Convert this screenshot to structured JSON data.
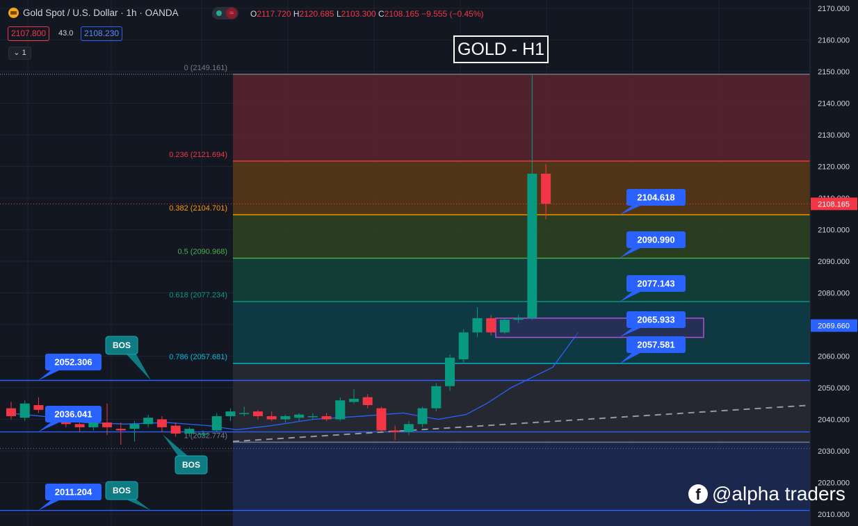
{
  "header": {
    "symbol_title": "Gold Spot / U.S. Dollar · 1h · OANDA",
    "ohlc": {
      "o_key": "O",
      "o": "2117.720",
      "h_key": "H",
      "h": "2120.685",
      "l_key": "L",
      "l": "2103.300",
      "c_key": "C",
      "c": "2108.165",
      "change": "−9.555 (−0.45%)"
    },
    "sell_price": "2107.800",
    "spread": "43.0",
    "buy_price": "2108.230",
    "indicator_count": "1",
    "toggle_wave": "≈"
  },
  "chart_title": "GOLD - H1",
  "watermark": "@alpha traders",
  "colors": {
    "bg": "#131722",
    "bull": "#089981",
    "bear": "#f23645",
    "axis_text": "#d1d4dc",
    "label_blue": "#2962ff",
    "bos": "#0f7b83"
  },
  "chart_data": {
    "type": "candlestick",
    "yrange": [
      2007,
      2172
    ],
    "price_axis_ticks": [
      "2170.000",
      "2160.000",
      "2150.000",
      "2140.000",
      "2130.000",
      "2120.000",
      "2110.000",
      "2100.000",
      "2090.000",
      "2080.000",
      "2070.000",
      "2060.000",
      "2050.000",
      "2040.000",
      "2030.000",
      "2020.000",
      "2010.000"
    ],
    "current_price": {
      "value": 2108.165,
      "label": "2108.165"
    },
    "ma_value": {
      "value": 2069.66,
      "label": "2069.660"
    },
    "fib_levels": [
      {
        "level": "0",
        "price": 2149.161,
        "label": "0 (2149.161)",
        "color": "#787b86"
      },
      {
        "level": "0.236",
        "price": 2121.694,
        "label": "0.236 (2121.694)",
        "color": "#f23645"
      },
      {
        "level": "0.382",
        "price": 2104.701,
        "label": "0.382 (2104.701)",
        "color": "#ff9800"
      },
      {
        "level": "0.5",
        "price": 2090.968,
        "label": "0.5 (2090.968)",
        "color": "#4caf50"
      },
      {
        "level": "0.618",
        "price": 2077.234,
        "label": "0.618 (2077.234)",
        "color": "#089981"
      },
      {
        "level": "0.786",
        "price": 2057.681,
        "label": "0.786 (2057.681)",
        "color": "#00bcd4"
      },
      {
        "level": "1",
        "price": 2032.774,
        "label": "1 (2032.774)",
        "color": "#787b86"
      }
    ],
    "price_labels": [
      {
        "text": "2104.618",
        "price": 2104.618
      },
      {
        "text": "2090.990",
        "price": 2090.99
      },
      {
        "text": "2077.143",
        "price": 2077.143
      },
      {
        "text": "2065.933",
        "price": 2065.933
      },
      {
        "text": "2057.581",
        "price": 2057.581
      }
    ],
    "structure_levels": [
      {
        "text": "2052.306",
        "price": 2052.306
      },
      {
        "text": "2036.041",
        "price": 2036.041
      },
      {
        "text": "2011.204",
        "price": 2011.204
      }
    ],
    "bos_label": "BOS",
    "candles": [
      {
        "o": 2043.5,
        "h": 2045.5,
        "l": 2040.0,
        "c": 2041.0
      },
      {
        "o": 2040.5,
        "h": 2046.0,
        "l": 2039.5,
        "c": 2045.0
      },
      {
        "o": 2044.5,
        "h": 2047.0,
        "l": 2042.0,
        "c": 2043.0
      },
      {
        "o": 2043.0,
        "h": 2044.0,
        "l": 2040.5,
        "c": 2041.0
      },
      {
        "o": 2040.5,
        "h": 2042.0,
        "l": 2037.5,
        "c": 2038.5
      },
      {
        "o": 2038.5,
        "h": 2039.5,
        "l": 2036.0,
        "c": 2037.5
      },
      {
        "o": 2037.5,
        "h": 2040.0,
        "l": 2036.5,
        "c": 2039.0
      },
      {
        "o": 2039.0,
        "h": 2045.0,
        "l": 2035.0,
        "c": 2037.5
      },
      {
        "o": 2037.0,
        "h": 2039.0,
        "l": 2032.0,
        "c": 2036.5
      },
      {
        "o": 2037.0,
        "h": 2039.5,
        "l": 2033.0,
        "c": 2038.5
      },
      {
        "o": 2038.5,
        "h": 2041.5,
        "l": 2037.5,
        "c": 2040.5
      },
      {
        "o": 2040.0,
        "h": 2041.0,
        "l": 2036.0,
        "c": 2037.5
      },
      {
        "o": 2038.0,
        "h": 2039.0,
        "l": 2034.5,
        "c": 2035.5
      },
      {
        "o": 2035.5,
        "h": 2037.5,
        "l": 2034.5,
        "c": 2037.0
      },
      {
        "o": 2035.5,
        "h": 2036.5,
        "l": 2034.5,
        "c": 2035.5
      },
      {
        "o": 2036.5,
        "h": 2042.0,
        "l": 2036.0,
        "c": 2041.0
      },
      {
        "o": 2041.0,
        "h": 2043.5,
        "l": 2039.5,
        "c": 2042.5
      },
      {
        "o": 2042.0,
        "h": 2044.0,
        "l": 2041.0,
        "c": 2042.0
      },
      {
        "o": 2042.5,
        "h": 2043.0,
        "l": 2040.0,
        "c": 2041.0
      },
      {
        "o": 2041.0,
        "h": 2042.5,
        "l": 2039.5,
        "c": 2040.0
      },
      {
        "o": 2040.0,
        "h": 2041.5,
        "l": 2039.0,
        "c": 2041.0
      },
      {
        "o": 2040.5,
        "h": 2042.0,
        "l": 2039.5,
        "c": 2041.5
      },
      {
        "o": 2041.0,
        "h": 2042.0,
        "l": 2040.0,
        "c": 2041.0
      },
      {
        "o": 2041.0,
        "h": 2042.0,
        "l": 2039.5,
        "c": 2040.0
      },
      {
        "o": 2040.0,
        "h": 2047.0,
        "l": 2039.5,
        "c": 2046.0
      },
      {
        "o": 2045.5,
        "h": 2049.5,
        "l": 2045.0,
        "c": 2046.5
      },
      {
        "o": 2047.0,
        "h": 2048.0,
        "l": 2043.5,
        "c": 2044.5
      },
      {
        "o": 2043.5,
        "h": 2044.0,
        "l": 2036.0,
        "c": 2036.5
      },
      {
        "o": 2036.5,
        "h": 2038.0,
        "l": 2033.5,
        "c": 2036.0
      },
      {
        "o": 2036.0,
        "h": 2039.5,
        "l": 2035.0,
        "c": 2038.5
      },
      {
        "o": 2038.5,
        "h": 2044.0,
        "l": 2037.5,
        "c": 2043.5
      },
      {
        "o": 2043.5,
        "h": 2051.5,
        "l": 2042.5,
        "c": 2050.5
      },
      {
        "o": 2050.5,
        "h": 2060.5,
        "l": 2049.0,
        "c": 2059.5
      },
      {
        "o": 2059.0,
        "h": 2068.5,
        "l": 2058.0,
        "c": 2067.5
      },
      {
        "o": 2067.5,
        "h": 2075.5,
        "l": 2066.0,
        "c": 2072.0
      },
      {
        "o": 2072.0,
        "h": 2073.0,
        "l": 2066.5,
        "c": 2067.5
      },
      {
        "o": 2067.5,
        "h": 2072.0,
        "l": 2067.0,
        "c": 2071.5
      },
      {
        "o": 2071.5,
        "h": 2073.0,
        "l": 2070.5,
        "c": 2072.0
      },
      {
        "o": 2072.0,
        "h": 2149.161,
        "l": 2071.5,
        "c": 2117.7
      },
      {
        "o": 2117.7,
        "h": 2120.685,
        "l": 2103.3,
        "c": 2108.165
      }
    ]
  }
}
